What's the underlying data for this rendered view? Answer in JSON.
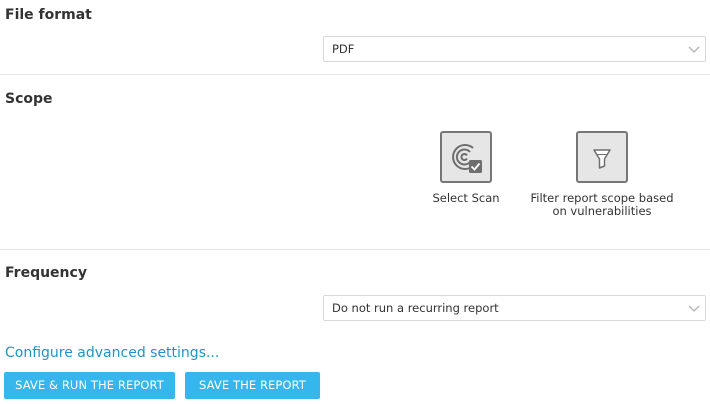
{
  "file_format": {
    "title": "File format",
    "selected": "PDF"
  },
  "scope": {
    "title": "Scope",
    "options": [
      {
        "label": "Select Scan",
        "icon": "scan-target-icon"
      },
      {
        "label_line1": "Filter report scope based",
        "label_line2": "on vulnerabilities",
        "icon": "funnel-icon"
      }
    ]
  },
  "frequency": {
    "title": "Frequency",
    "selected": "Do not run a recurring report"
  },
  "advanced_link": "Configure advanced settings...",
  "buttons": {
    "save_and_run": "SAVE & RUN THE REPORT",
    "save": "SAVE THE REPORT"
  },
  "colors": {
    "accent": "#35b7ee",
    "link": "#1f95c5",
    "tile_border": "#767676",
    "tile_bg": "#e6e6e6"
  }
}
